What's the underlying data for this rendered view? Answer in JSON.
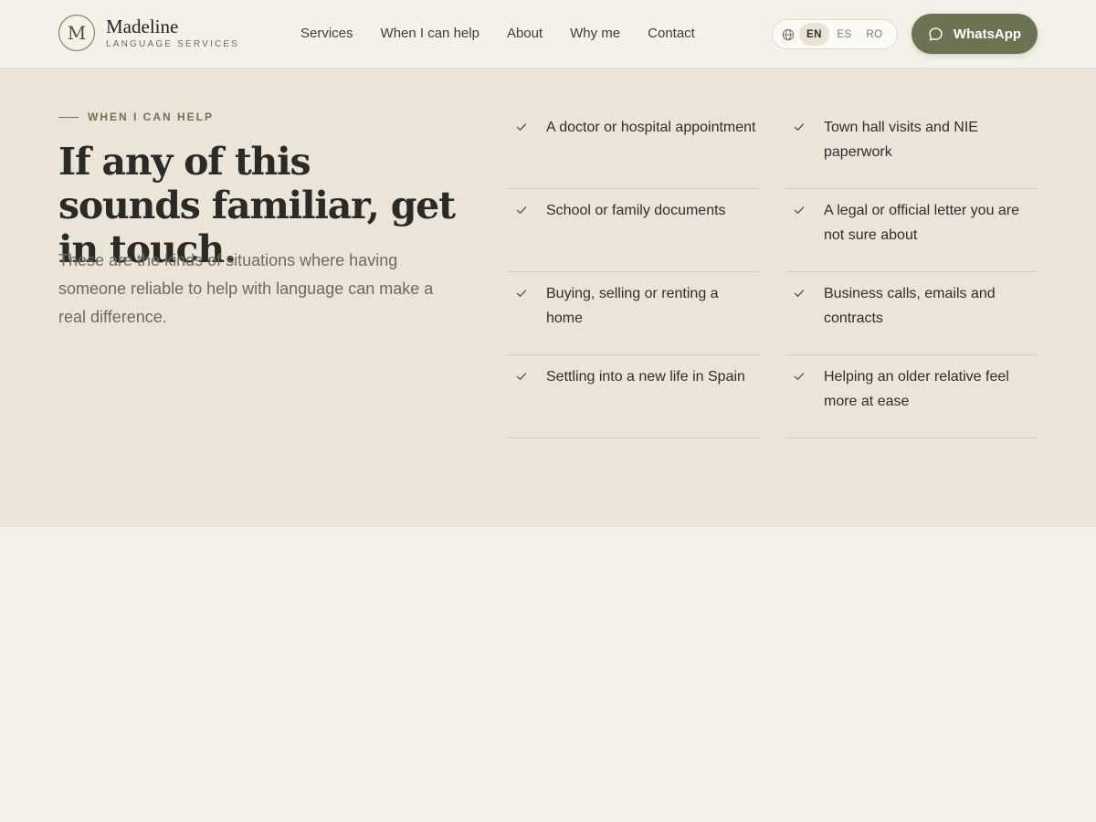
{
  "header": {
    "brand": {
      "monogram": "M",
      "name": "Madeline",
      "tagline": "LANGUAGE SERVICES"
    },
    "nav": [
      "Services",
      "When I can help",
      "About",
      "Why me",
      "Contact"
    ],
    "languages": {
      "icon": "globe-icon",
      "options": [
        "EN",
        "ES",
        "RO"
      ],
      "selected": "EN"
    },
    "cta": {
      "label": "WhatsApp",
      "icon": "chat-bubble-icon",
      "color": "#6d7352"
    }
  },
  "section": {
    "eyebrow": "WHEN I CAN HELP",
    "headline": "If any of this sounds familiar, get in touch.",
    "lead": "These are the kinds of situations where having someone reliable to help with language can make a real difference.",
    "items": [
      "A doctor or hospital appointment",
      "Town hall visits and NIE paperwork",
      "School or family documents",
      "A legal or official letter you are not sure about",
      "Buying, selling or renting a home",
      "Business calls, emails and contracts",
      "Settling into a new life in Spain",
      "Helping an older relative feel more at ease"
    ],
    "item_icon": "check-icon"
  },
  "colors": {
    "accent": "#6d7352",
    "page_background": "#f3f0e8",
    "section_background": "#ebe4d8"
  }
}
